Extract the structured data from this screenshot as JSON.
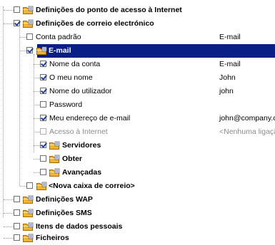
{
  "tree": {
    "internet_access_point": "Definições do ponto de acesso à Internet",
    "email_settings": "Definições de correio electrónico",
    "default_account": {
      "label": "Conta padrão",
      "value": "E-mail"
    },
    "email_node": "E-mail",
    "account_name": {
      "label": "Nome da conta",
      "value": "E-mail"
    },
    "my_name": {
      "label": "O meu nome",
      "value": "John"
    },
    "username": {
      "label": "Nome do utilizador",
      "value": "john"
    },
    "password": {
      "label": "Password",
      "value": ""
    },
    "my_email": {
      "label": "Meu endereço de e-mail",
      "value": "john@company.com"
    },
    "internet_access": {
      "label": "Acesso à Internet",
      "value": "<Nenhuma ligação>"
    },
    "servers": "Servidores",
    "get": "Obter",
    "advanced": "Avançadas",
    "new_mailbox": "<Nova caixa de correio>",
    "wap": "Definições WAP",
    "sms": "Definições SMS",
    "personal_data": "Itens de dados pessoais",
    "files": "Ficheiros"
  },
  "colors": {
    "selection": "#0a1f86",
    "folder": "#f2b233"
  }
}
